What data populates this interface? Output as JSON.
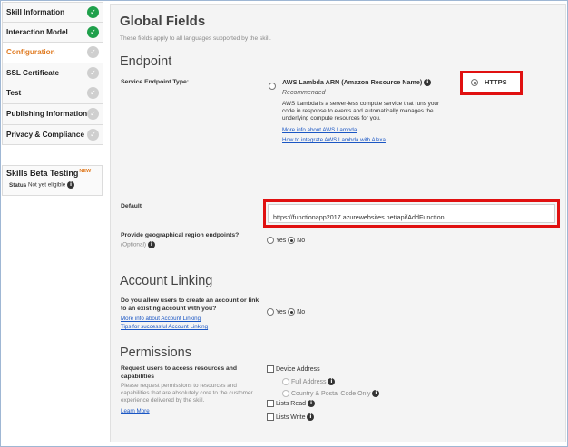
{
  "sidebar": {
    "items": [
      {
        "label": "Skill Information",
        "done": true
      },
      {
        "label": "Interaction Model",
        "done": true
      },
      {
        "label": "Configuration",
        "done": false
      },
      {
        "label": "SSL Certificate",
        "done": false
      },
      {
        "label": "Test",
        "done": false
      },
      {
        "label": "Publishing Information",
        "done": false
      },
      {
        "label": "Privacy & Compliance",
        "done": false
      }
    ],
    "active_item": "Configuration",
    "check_glyph": "✓",
    "beta": {
      "title": "Skills Beta Testing",
      "badge": "NEW",
      "status_label": "Status",
      "status_value": "Not yet eligible"
    }
  },
  "main": {
    "title": "Global Fields",
    "subtitle": "These fields apply to all languages supported by the skill.",
    "endpoint": {
      "heading": "Endpoint",
      "type_label": "Service Endpoint Type:",
      "lambda_label": "AWS Lambda ARN (Amazon Resource Name)",
      "lambda_recommended": "Recommended",
      "lambda_desc": "AWS Lambda is a server-less compute service that runs your code in response to events and automatically manages the underlying compute resources for you.",
      "lambda_link1": "More info about AWS Lambda",
      "lambda_link2": "How to integrate AWS Lambda with Alexa",
      "https_label": "HTTPS",
      "selected": "HTTPS",
      "default_label": "Default",
      "default_value": "https://functionapp2017.azurewebsites.net/api/AddFunction",
      "geo_label": "Provide geographical region endpoints?",
      "geo_optional": "(Optional)",
      "geo_yes": "Yes",
      "geo_no": "No",
      "geo_selected": "No"
    },
    "account_linking": {
      "heading": "Account Linking",
      "question": "Do you allow users to create an account or link to an existing account with you?",
      "link1": "More info about Account Linking",
      "link2": "Tips for successful Account Linking",
      "yes": "Yes",
      "no": "No",
      "selected": "No"
    },
    "permissions": {
      "heading": "Permissions",
      "label": "Request users to access resources and capabilities",
      "desc": "Please request permissions to resources and capabilities that are absolutely core to the customer experience delivered by the skill.",
      "learn_more": "Learn More",
      "device_address": "Device Address",
      "full_address": "Full Address",
      "country_postal": "Country & Postal Code Only",
      "lists_read": "Lists Read",
      "lists_write": "Lists Write"
    }
  },
  "colors": {
    "highlight": "#e01010",
    "done": "#1fa04b",
    "active": "#e07b22",
    "link": "#1a56c4"
  },
  "icons": {
    "info": "info-icon",
    "check": "check-circle-icon"
  }
}
